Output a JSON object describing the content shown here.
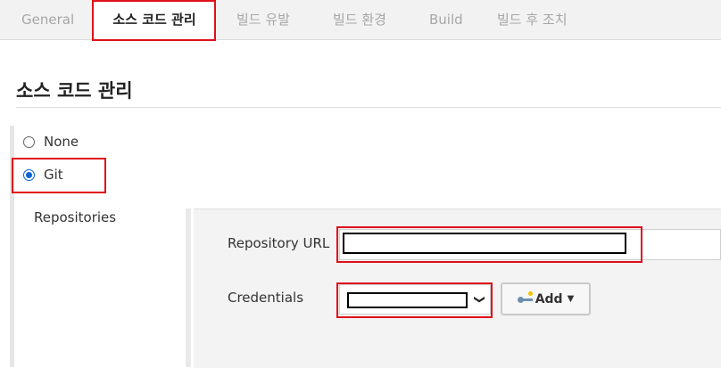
{
  "tabs": [
    {
      "label": "General"
    },
    {
      "label": "소스 코드 관리"
    },
    {
      "label": "빌드 유발"
    },
    {
      "label": "빌드 환경"
    },
    {
      "label": "Build"
    },
    {
      "label": "빌드 후 조치"
    }
  ],
  "active_tab": "소스 코드 관리",
  "section": {
    "title": "소스 코드 관리"
  },
  "scm_options": [
    {
      "label": "None",
      "checked": false
    },
    {
      "label": "Git",
      "checked": true
    }
  ],
  "repositories": {
    "label": "Repositories",
    "url_label": "Repository URL",
    "url_value": "",
    "credentials_label": "Credentials",
    "credentials_value": "",
    "add_label": "Add"
  },
  "colors": {
    "highlight": "#e0101a",
    "radio_selected": "#0a64d6"
  },
  "icons": [
    "key-icon",
    "caret-down-icon",
    "chevron-down-icon"
  ]
}
